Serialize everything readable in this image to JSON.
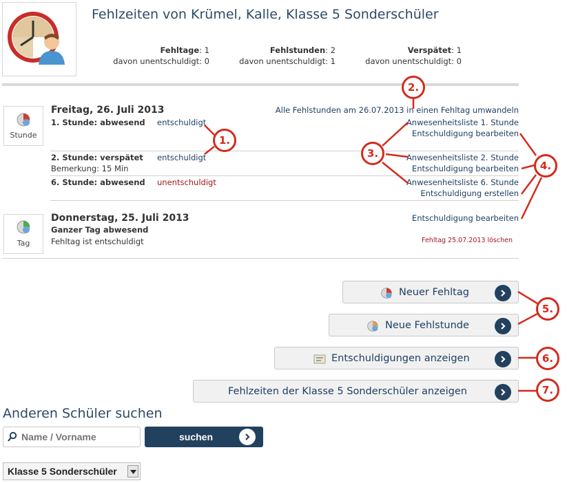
{
  "header": {
    "title": "Fehlzeiten von Krümel, Kalle, Klasse 5 Sonderschüler",
    "stats": [
      {
        "label": "Fehltage",
        "value": "1",
        "sub_label": "davon unentschuldigt",
        "sub_value": "0"
      },
      {
        "label": "Fehlstunden",
        "value": "2",
        "sub_label": "davon unentschuldigt",
        "sub_value": "1"
      },
      {
        "label": "Verspätet",
        "value": "1",
        "sub_label": "davon unentschuldigt",
        "sub_value": "0"
      }
    ]
  },
  "days": [
    {
      "icon_label": "Stunde",
      "title": "Freitag, 26. Juli 2013",
      "convert_link": "Alle Fehlstunden am 26.07.2013 in einen Fehltag umwandeln",
      "entries": [
        {
          "label": "1. Stunde: abwesend",
          "status": "entschuldigt",
          "attendance_link": "Anwesenheitsliste 1. Stunde",
          "excuse_link": "Entschuldigung bearbeiten"
        },
        {
          "label": "2. Stunde: verspätet",
          "status": "entschuldigt",
          "note": "Bemerkung: 15 Min",
          "attendance_link": "Anwesenheitsliste 2. Stunde",
          "excuse_link": "Entschuldigung bearbeiten"
        },
        {
          "label": "6. Stunde: abwesend",
          "status": "unentschuldigt",
          "attendance_link": "Anwesenheitsliste 6. Stunde",
          "excuse_link": "Entschuldigung erstellen"
        }
      ]
    },
    {
      "icon_label": "Tag",
      "title": "Donnerstag, 25. Juli 2013",
      "subtitle": "Ganzer Tag abwesend",
      "note": "Fehltag ist entschuldigt",
      "excuse_link": "Entschuldigung bearbeiten",
      "delete_link": "Fehltag 25.07.2013 löschen"
    }
  ],
  "buttons": {
    "new_absence_day": "Neuer Fehltag",
    "new_absence_lesson": "Neue Fehlstunde",
    "show_excuses": "Entschuldigungen anzeigen",
    "show_class_absences": "Fehlzeiten der Klasse 5 Sonderschüler anzeigen"
  },
  "callouts": [
    "1.",
    "2.",
    "3.",
    "4.",
    "5.",
    "6.",
    "7."
  ],
  "search": {
    "heading": "Anderen Schüler suchen",
    "placeholder": "Name / Vorname",
    "button": "suchen",
    "class_select": "Klasse 5 Sonderschüler"
  },
  "colors": {
    "accent": "#22415f",
    "callout": "#d42a1c",
    "unexcused": "#a5141e"
  }
}
